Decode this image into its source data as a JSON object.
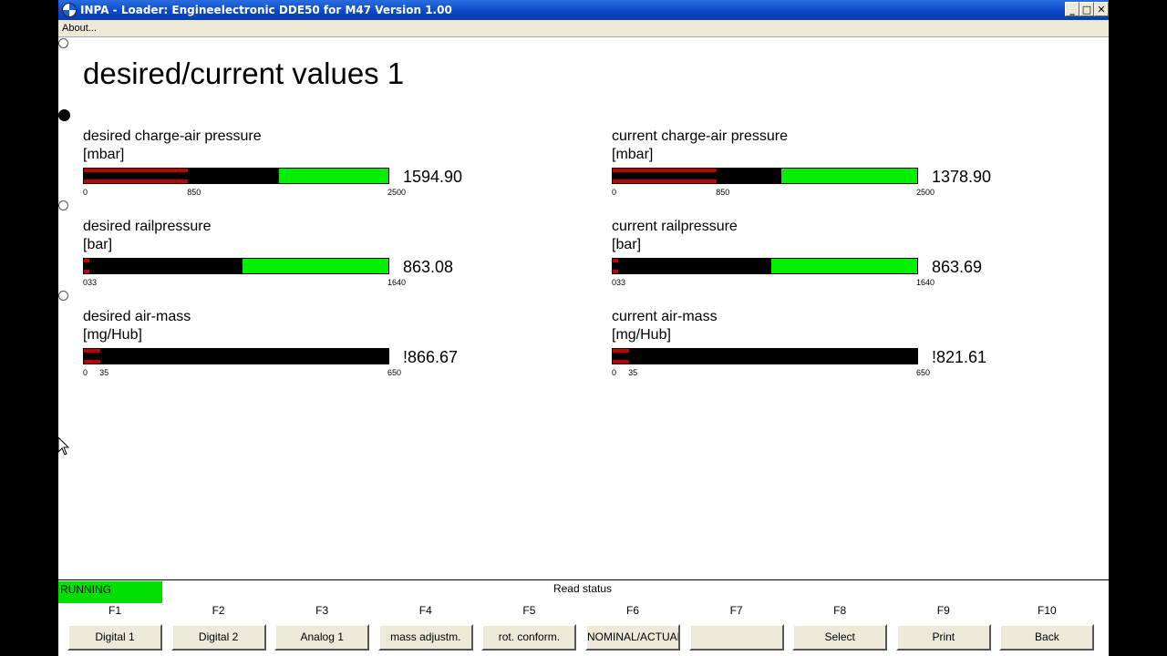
{
  "window": {
    "title": "INPA - Loader:  Engineelectronic DDE50 for M47 Version 1.00",
    "min_glyph": "_",
    "max_glyph": "□",
    "close_glyph": "✕"
  },
  "menu": {
    "about": "About..."
  },
  "page_title": "desired/current values 1",
  "gauges": [
    {
      "label": "desired charge-air pressure",
      "unit": "[mbar]",
      "value_text": "1594.90",
      "min": 0,
      "max": 2500,
      "warn": 850,
      "value": 1594.9,
      "ticks": [
        "0",
        "850",
        "2500"
      ]
    },
    {
      "label": "current charge-air pressure",
      "unit": "[mbar]",
      "value_text": "1378.90",
      "min": 0,
      "max": 2500,
      "warn": 850,
      "value": 1378.9,
      "ticks": [
        "0",
        "850",
        "2500"
      ]
    },
    {
      "label": "desired railpressure",
      "unit": "[bar]",
      "value_text": "863.08",
      "min": 33,
      "max": 1640,
      "warn": 33,
      "value": 863.08,
      "ticks": [
        "033",
        "1640"
      ]
    },
    {
      "label": "current railpressure",
      "unit": "[bar]",
      "value_text": "863.69",
      "min": 33,
      "max": 1640,
      "warn": 33,
      "value": 863.69,
      "ticks": [
        "033",
        "1640"
      ]
    },
    {
      "label": "desired air-mass",
      "unit": "[mg/Hub]",
      "value_text": "!866.67",
      "min": 0,
      "max": 650,
      "warn": 35,
      "value": 650,
      "ticks": [
        "0",
        "35",
        "650"
      ]
    },
    {
      "label": "current air-mass",
      "unit": "[mg/Hub]",
      "value_text": "!821.61",
      "min": 0,
      "max": 650,
      "warn": 35,
      "value": 650,
      "ticks": [
        "0",
        "35",
        "650"
      ]
    }
  ],
  "status": {
    "running": "RUNNING",
    "read_status": "Read status",
    "running_color": "#00e000"
  },
  "fkeys": [
    {
      "key": "F1",
      "label": "Digital 1"
    },
    {
      "key": "F2",
      "label": "Digital 2"
    },
    {
      "key": "F3",
      "label": "Analog 1"
    },
    {
      "key": "F4",
      "label": "mass adjustm."
    },
    {
      "key": "F5",
      "label": "rot. conform."
    },
    {
      "key": "F6",
      "label": "NOMINAL/ACTUAL"
    },
    {
      "key": "F7",
      "label": ""
    },
    {
      "key": "F8",
      "label": "Select"
    },
    {
      "key": "F9",
      "label": "Print"
    },
    {
      "key": "F10",
      "label": "Back"
    }
  ],
  "colors": {
    "bar_ok": "#00f000",
    "bar_warn": "#c00000",
    "bar_fill": "#000000",
    "titlebar": "#0a46c8"
  }
}
